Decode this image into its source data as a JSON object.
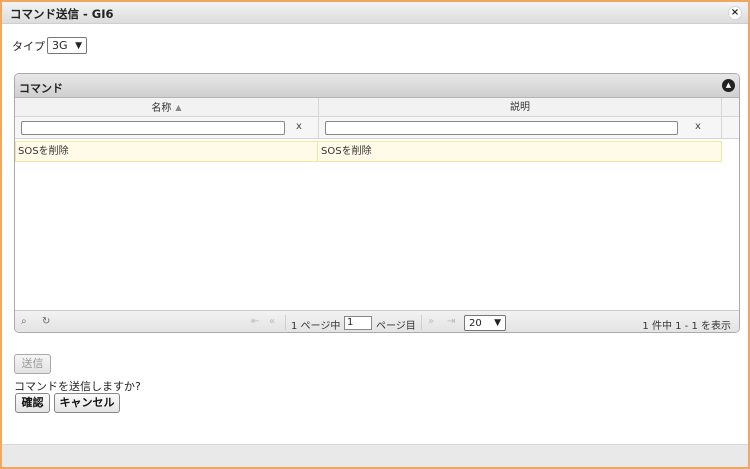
{
  "dialog": {
    "title": "コマンド送信 - GI6",
    "close_label": "×"
  },
  "type_selector": {
    "label": "タイプ",
    "value": "3G"
  },
  "panel": {
    "title": "コマンド",
    "columns": [
      "名称",
      "説明"
    ],
    "filter_clear": "x",
    "rows": [
      {
        "name": "SOSを削除",
        "description": "SOSを削除"
      }
    ]
  },
  "pager": {
    "current_page": "1",
    "page_prefix": "1 ページ中",
    "page_suffix": "ページ目",
    "rows_per_page": "20",
    "info": "1 件中 1 - 1 を表示"
  },
  "actions": {
    "send_label": "送信",
    "confirm_message": "コマンドを送信しますか?",
    "ok_label": "確認",
    "cancel_label": "キャンセル"
  },
  "colors": {
    "dialog_border": "#f0a860",
    "row_highlight": "#fffbe8"
  },
  "icons": {
    "collapse": "circle-triangle-up-icon",
    "sort": "sort-icon",
    "search": "search-icon",
    "refresh": "refresh-icon"
  }
}
